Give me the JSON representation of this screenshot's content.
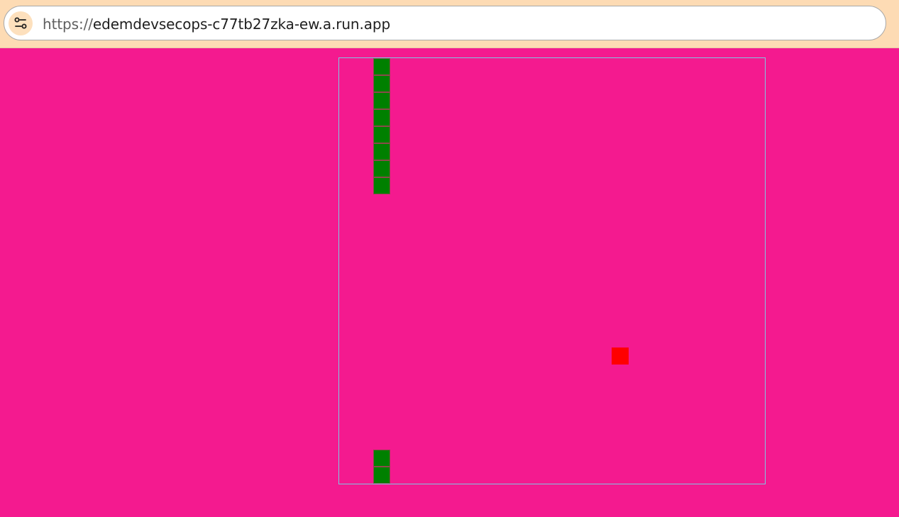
{
  "colors": {
    "browser_bar": "#fddbb4",
    "page_background": "#f41a8f",
    "board_border": "#7ec8e3",
    "snake": "#008000",
    "snake_segment_border": "#8a4a4a",
    "food": "#ff0000"
  },
  "browser": {
    "site_info_icon": "tune-icon",
    "url_scheme": "https://",
    "url_host": "edemdevsecops-c77tb27zka-ew.a.run.app"
  },
  "game": {
    "grid": {
      "columns": 25,
      "rows": 25
    },
    "snake": [
      {
        "col": 2,
        "row": 0
      },
      {
        "col": 2,
        "row": 1
      },
      {
        "col": 2,
        "row": 2
      },
      {
        "col": 2,
        "row": 3
      },
      {
        "col": 2,
        "row": 4
      },
      {
        "col": 2,
        "row": 5
      },
      {
        "col": 2,
        "row": 6
      },
      {
        "col": 2,
        "row": 7
      },
      {
        "col": 2,
        "row": 23
      },
      {
        "col": 2,
        "row": 24
      }
    ],
    "food": {
      "col": 16,
      "row": 17
    }
  }
}
